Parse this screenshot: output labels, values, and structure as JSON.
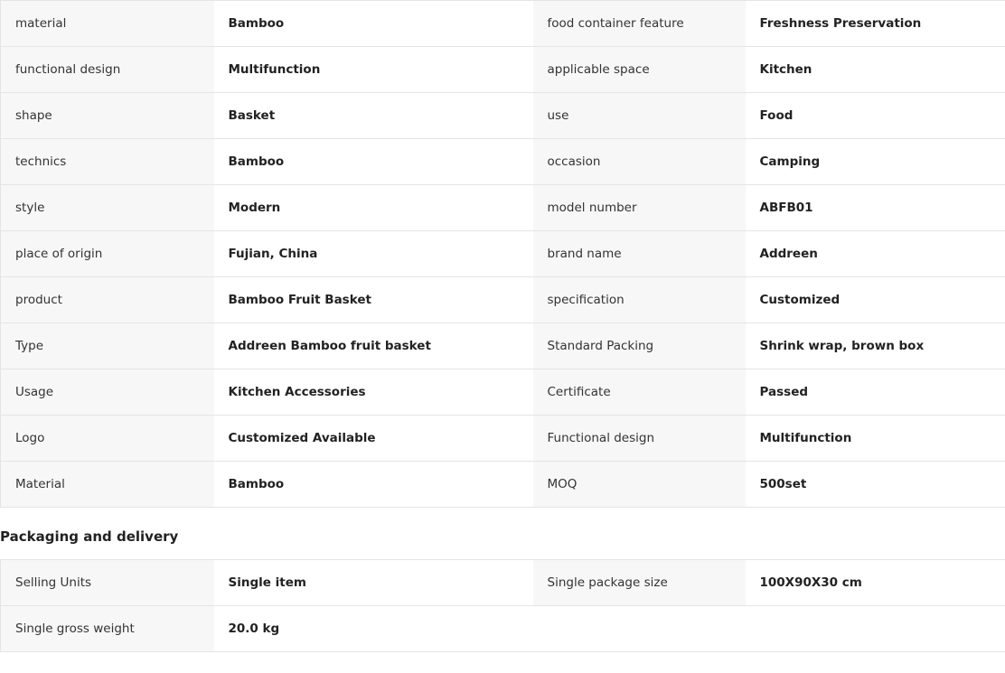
{
  "attributes": {
    "rows": [
      {
        "k1": "material",
        "v1": "Bamboo",
        "k2": "food container feature",
        "v2": "Freshness Preservation"
      },
      {
        "k1": "functional design",
        "v1": "Multifunction",
        "k2": "applicable space",
        "v2": "Kitchen"
      },
      {
        "k1": "shape",
        "v1": "Basket",
        "k2": "use",
        "v2": "Food"
      },
      {
        "k1": "technics",
        "v1": "Bamboo",
        "k2": "occasion",
        "v2": "Camping"
      },
      {
        "k1": "style",
        "v1": "Modern",
        "k2": "model number",
        "v2": "ABFB01"
      },
      {
        "k1": "place of origin",
        "v1": "Fujian, China",
        "k2": "brand name",
        "v2": "Addreen"
      },
      {
        "k1": "product",
        "v1": "Bamboo Fruit Basket",
        "k2": "specification",
        "v2": "Customized"
      },
      {
        "k1": "Type",
        "v1": "Addreen Bamboo fruit basket",
        "k2": "Standard Packing",
        "v2": "Shrink wrap, brown box"
      },
      {
        "k1": "Usage",
        "v1": "Kitchen Accessories",
        "k2": "Certificate",
        "v2": "Passed"
      },
      {
        "k1": "Logo",
        "v1": "Customized Available",
        "k2": "Functional design",
        "v2": "Multifunction"
      },
      {
        "k1": "Material",
        "v1": "Bamboo",
        "k2": "MOQ",
        "v2": "500set"
      }
    ]
  },
  "packaging": {
    "title": "Packaging and delivery",
    "rows": [
      {
        "k1": "Selling Units",
        "v1": "Single item",
        "k2": "Single package size",
        "v2": "100X90X30 cm"
      },
      {
        "k1": "Single gross weight",
        "v1": "20.0 kg",
        "k2": "",
        "v2": ""
      }
    ]
  }
}
